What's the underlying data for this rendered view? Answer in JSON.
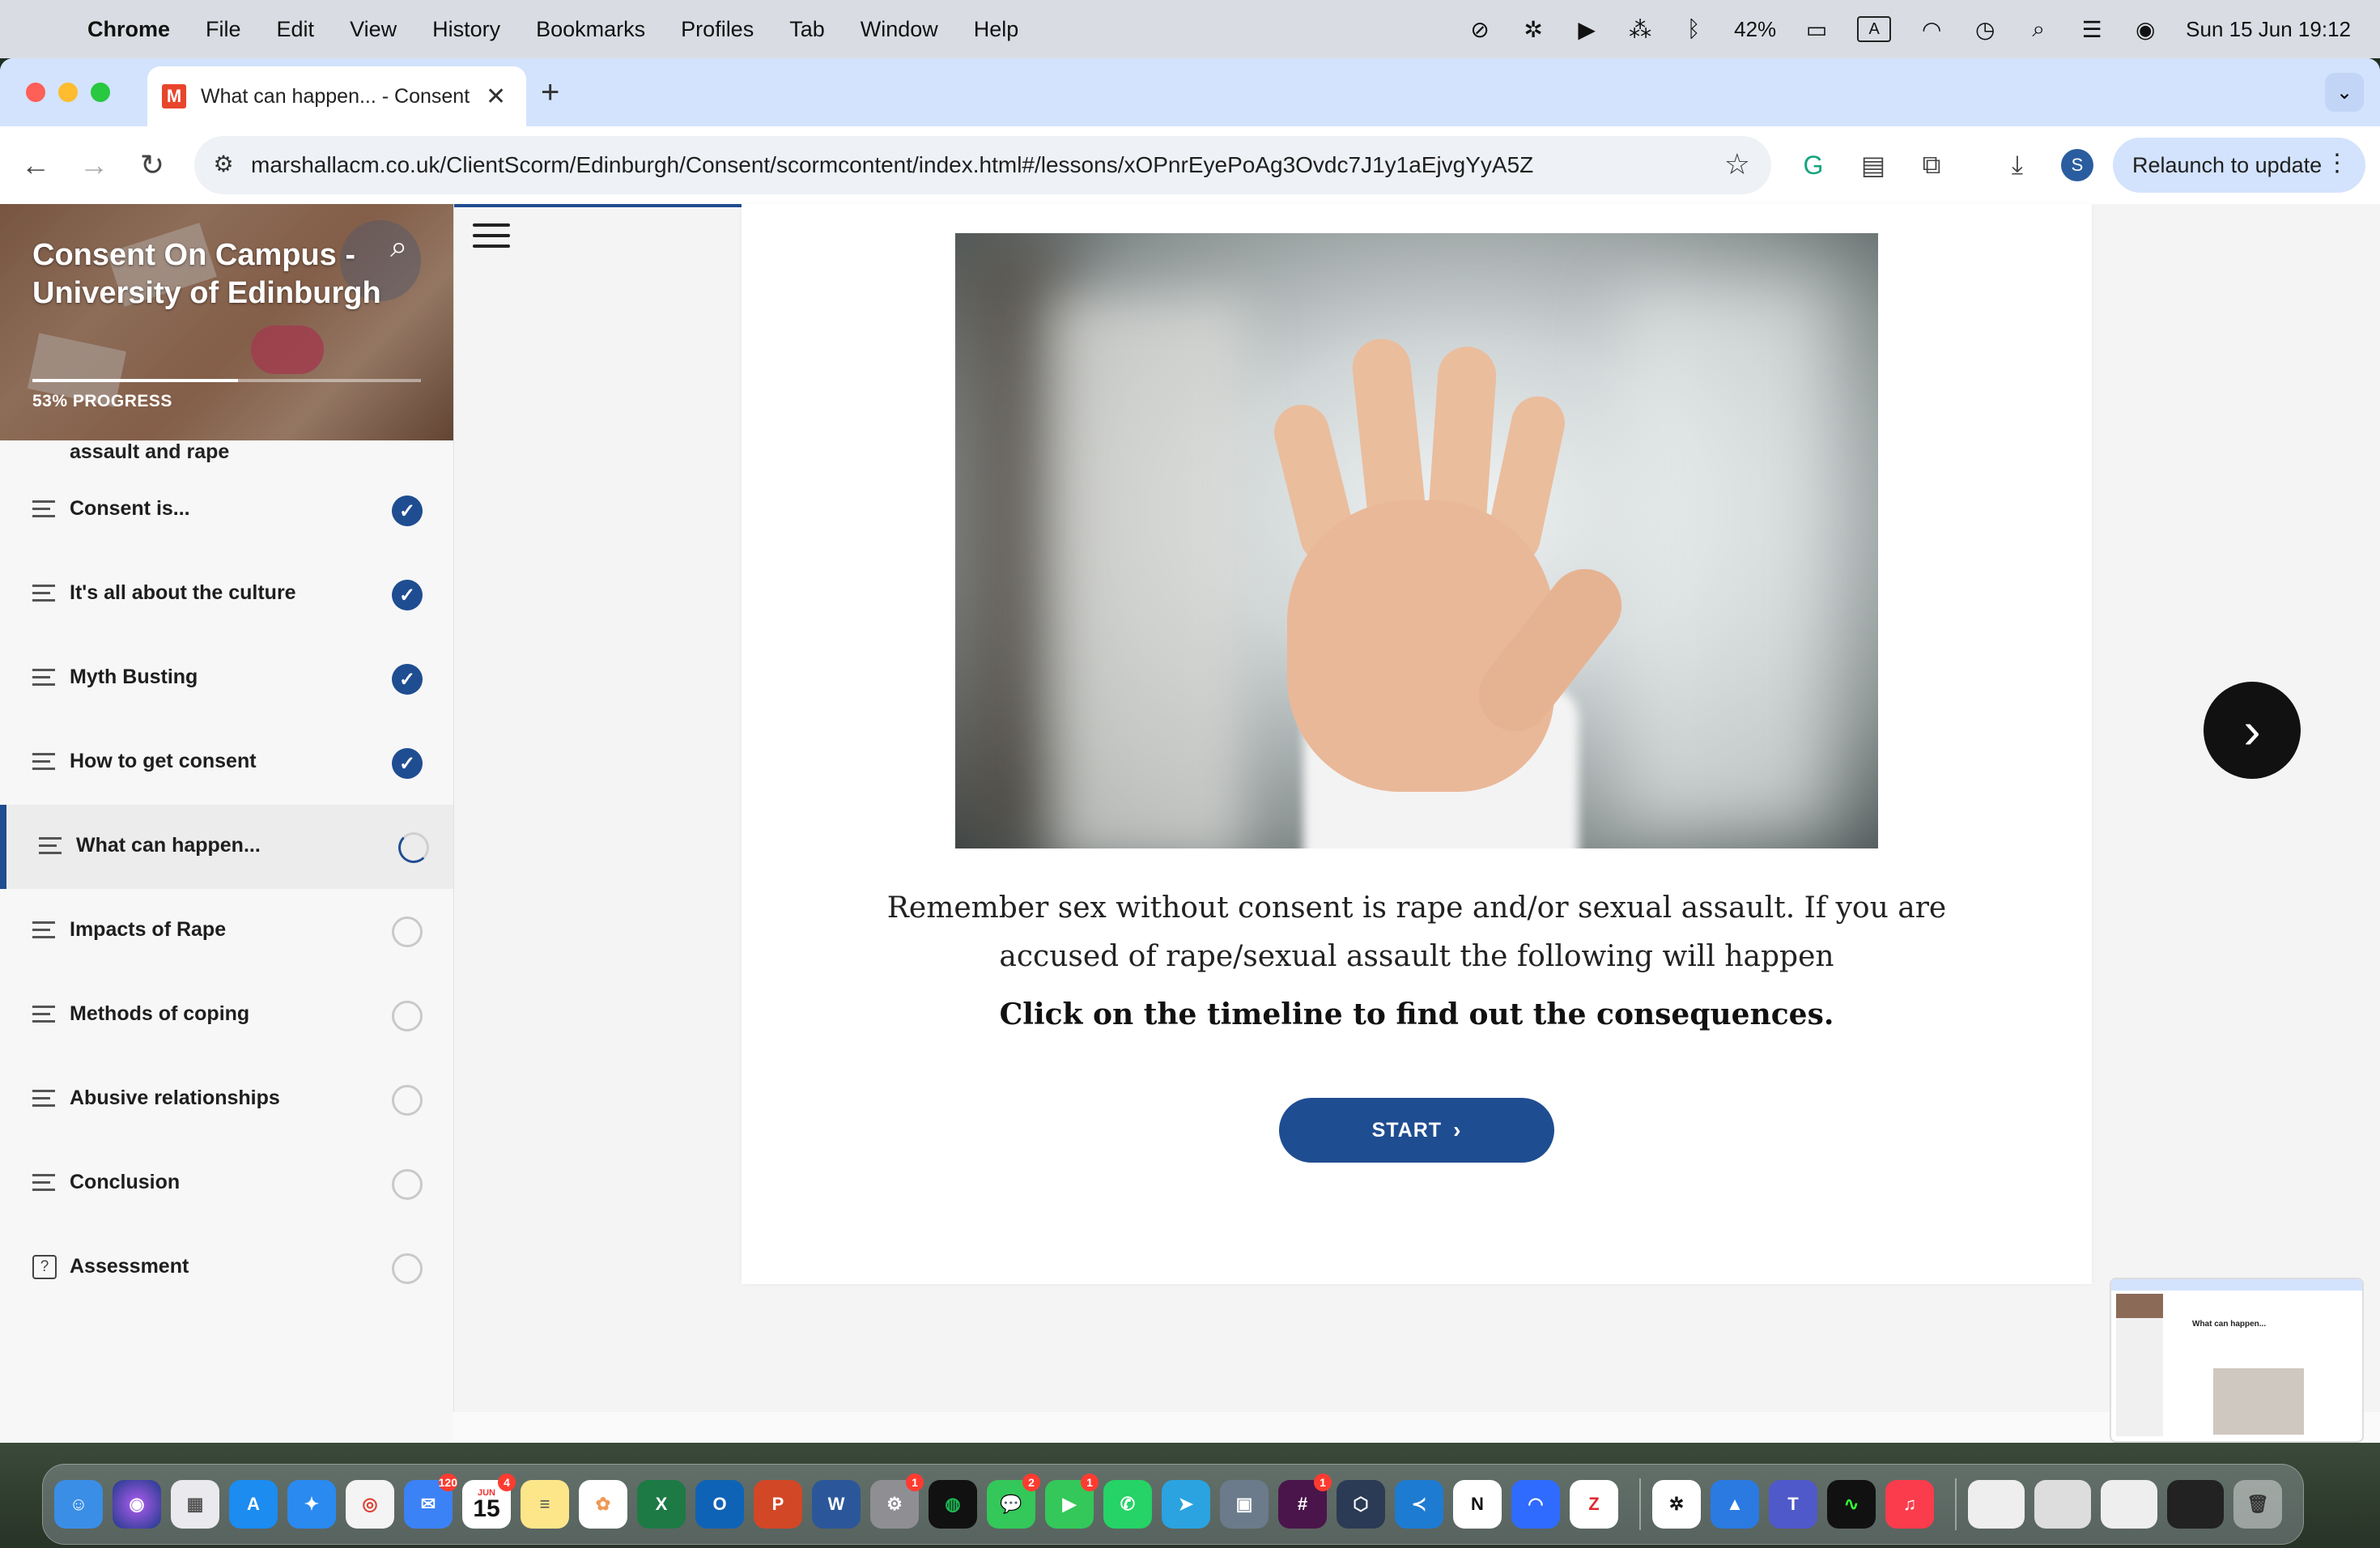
{
  "menubar": {
    "app_name": "Chrome",
    "items": [
      "File",
      "Edit",
      "View",
      "History",
      "Bookmarks",
      "Profiles",
      "Tab",
      "Window",
      "Help"
    ],
    "battery": "42%",
    "input_badge": "A",
    "datetime": "Sun 15 Jun  19:12"
  },
  "browser": {
    "tab_title": "What can happen... - Consent",
    "tab_favicon": "M",
    "url": "marshallacm.co.uk/ClientScorm/Edinburgh/Consent/scormcontent/index.html#/lessons/xOPnrEyePoAg3Ovdc7J1y1aEjvgYyA5Z",
    "profile_initial": "S",
    "relaunch_label": "Relaunch to update"
  },
  "sidebar": {
    "course_title": "Consent On Campus - University of Edinburgh",
    "progress_percent": 53,
    "progress_label": "53% PROGRESS",
    "cut_off_item": "assault and rape",
    "lessons": [
      {
        "label": "Consent is...",
        "status": "complete"
      },
      {
        "label": "It's all about the culture",
        "status": "complete"
      },
      {
        "label": "Myth Busting",
        "status": "complete"
      },
      {
        "label": "How to get consent",
        "status": "complete"
      },
      {
        "label": "What can happen...",
        "status": "in-progress"
      },
      {
        "label": "Impacts of Rape",
        "status": "not-started"
      },
      {
        "label": "Methods of coping",
        "status": "not-started"
      },
      {
        "label": "Abusive relationships",
        "status": "not-started"
      },
      {
        "label": "Conclusion",
        "status": "not-started"
      },
      {
        "label": "Assessment",
        "status": "not-started"
      }
    ]
  },
  "lesson": {
    "body_text": "Remember sex without consent is rape and/or sexual assault. If you are accused of rape/sexual assault the following will happen",
    "instruction": "Click on the timeline to find out the consequences.",
    "start_label": "START",
    "thumbnail_title": "What can happen..."
  },
  "dock": {
    "calendar_month": "JUN",
    "calendar_day": "15",
    "badges": {
      "mail": "120",
      "calendar": "4",
      "settings": "1",
      "messages": "2",
      "facetime": "1",
      "slack": "1"
    }
  },
  "colors": {
    "accent": "#1f4d91",
    "tab_strip": "#d3e3fd",
    "menubar": "#d9dde3"
  }
}
